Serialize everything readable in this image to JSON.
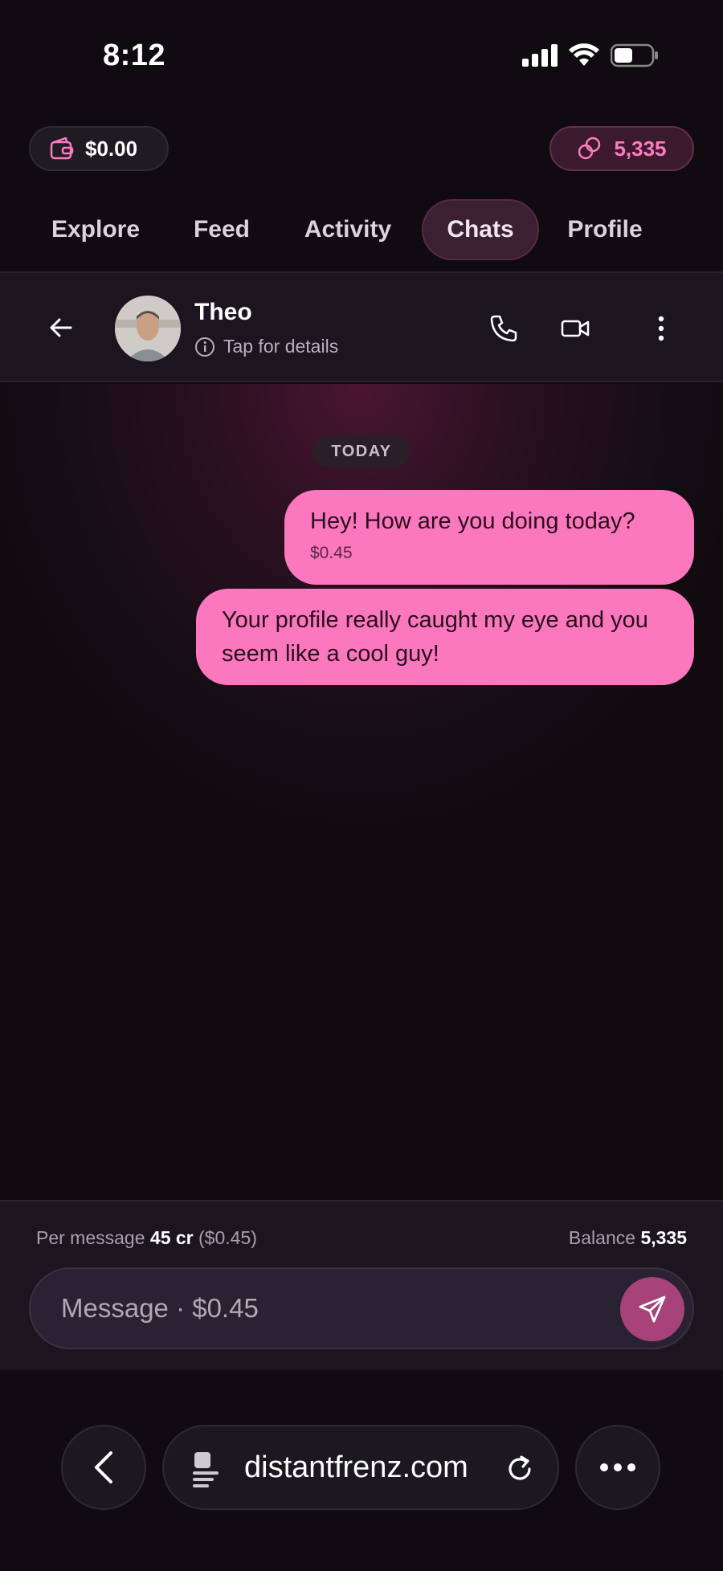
{
  "status_bar": {
    "time": "8:12"
  },
  "wallet": {
    "balance": "$0.00"
  },
  "credits": {
    "amount": "5,335",
    "color": "#ff7ac1"
  },
  "tabs": [
    {
      "label": "Explore"
    },
    {
      "label": "Feed"
    },
    {
      "label": "Activity"
    },
    {
      "label": "Chats",
      "active": true
    },
    {
      "label": "Profile"
    }
  ],
  "chat_header": {
    "name": "Theo",
    "subtitle": "Tap for details"
  },
  "chat": {
    "date_label": "TODAY",
    "messages": [
      {
        "text": "Hey! How are you doing today?",
        "price": "$0.45"
      },
      {
        "text": "Your profile really caught my eye and you seem like a cool guy!"
      }
    ],
    "bubble_color": "#fb78be"
  },
  "composer": {
    "per_message_label": "Per message",
    "per_message_cr": "45 cr",
    "per_message_usd": "($0.45)",
    "balance_label": "Balance",
    "balance_value": "5,335",
    "placeholder": "Message · $0.45"
  },
  "browser": {
    "url": "distantfrenz.com"
  }
}
